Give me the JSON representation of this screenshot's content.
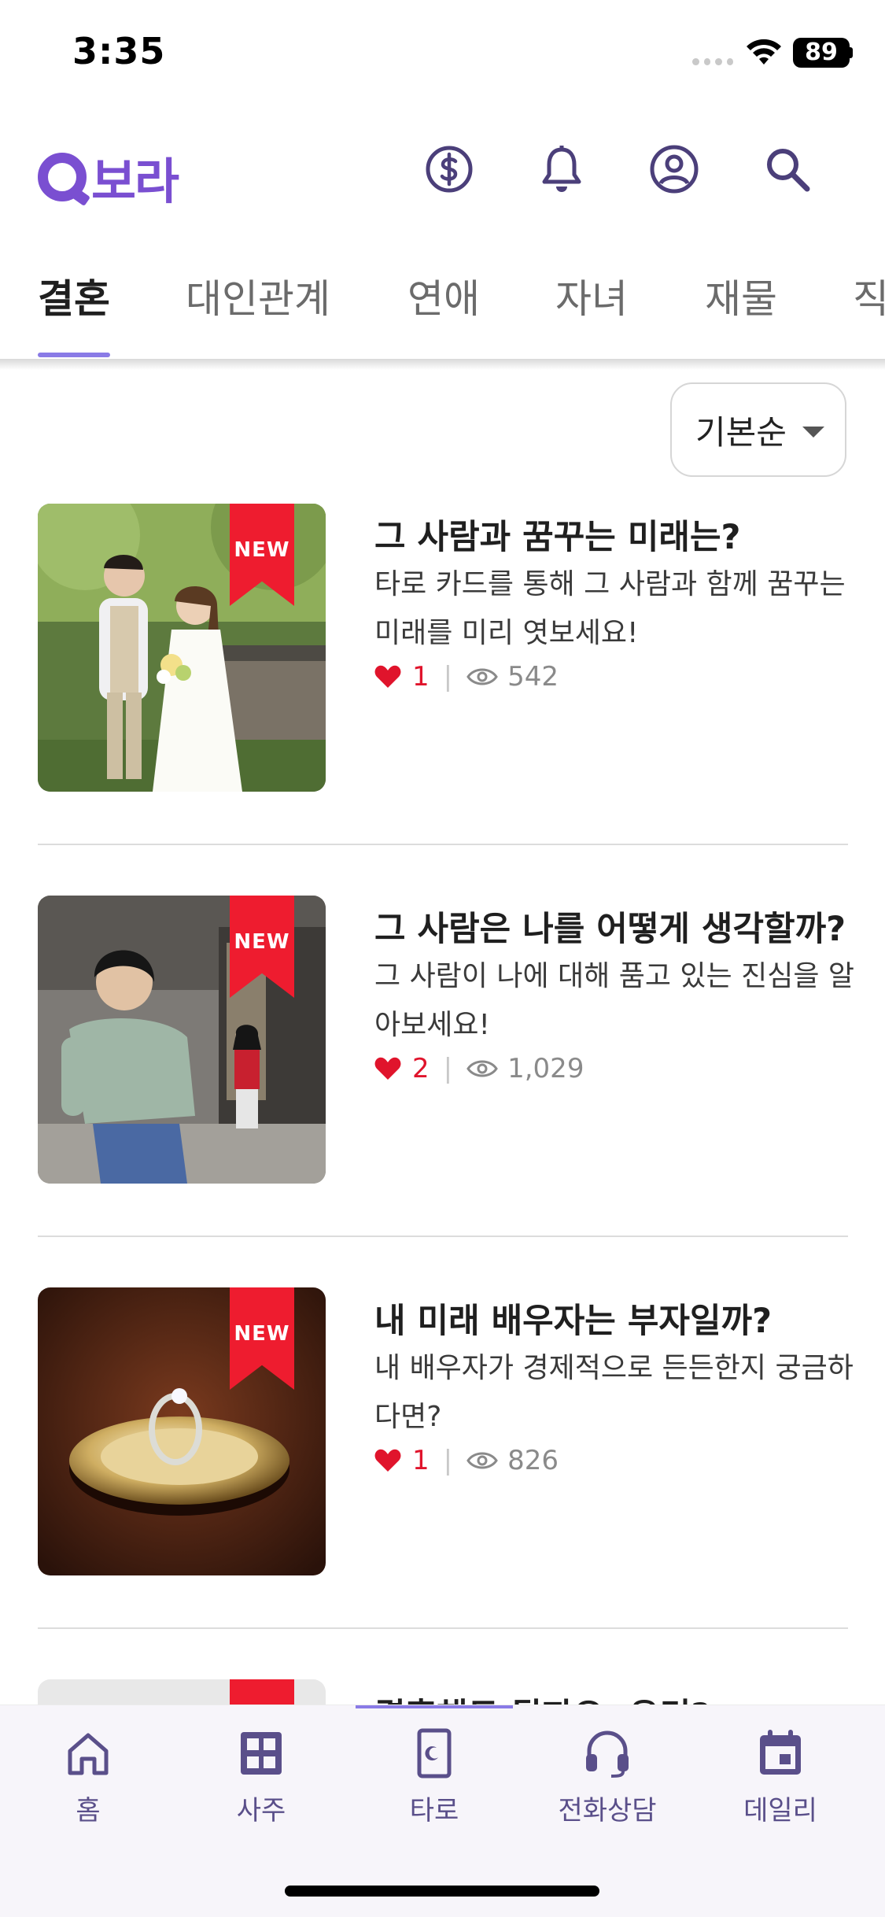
{
  "status_bar": {
    "time": "3:35",
    "battery": "89"
  },
  "header": {
    "logo_text": "보라"
  },
  "tabs": [
    {
      "label": "결혼",
      "active": true
    },
    {
      "label": "대인관계",
      "active": false
    },
    {
      "label": "연애",
      "active": false
    },
    {
      "label": "자녀",
      "active": false
    },
    {
      "label": "재물",
      "active": false
    },
    {
      "label": "직",
      "active": false
    }
  ],
  "sort": {
    "label": "기본순"
  },
  "items": [
    {
      "title": "그 사람과 꿈꾸는 미래는?",
      "description": "타로 카드를 통해 그 사람과 함께 꿈꾸는 미래를 미리 엿보세요!",
      "likes": "1",
      "views": "542",
      "badge": "NEW"
    },
    {
      "title": "그 사람은 나를 어떻게 생각할까?",
      "description": "그 사람이 나에 대해 품고 있는 진심을 알아보세요!",
      "likes": "2",
      "views": "1,029",
      "badge": "NEW"
    },
    {
      "title": "내 미래 배우자는 부자일까?",
      "description": "내 배우자가 경제적으로 든든한지 궁금하다면?",
      "likes": "1",
      "views": "826",
      "badge": "NEW"
    }
  ],
  "partial_item": {
    "title": "결혼해도 될까요, 우리?"
  },
  "bottom_nav": [
    {
      "label": "홈",
      "icon": "home-icon"
    },
    {
      "label": "사주",
      "icon": "grid-icon"
    },
    {
      "label": "타로",
      "icon": "tarot-card-icon"
    },
    {
      "label": "전화상담",
      "icon": "headset-icon"
    },
    {
      "label": "데일리",
      "icon": "calendar-icon"
    }
  ],
  "colors": {
    "brand": "#7a4fd1",
    "like": "#e0142c",
    "badge": "#ee1c2f",
    "nav": "#5a4f8a"
  }
}
